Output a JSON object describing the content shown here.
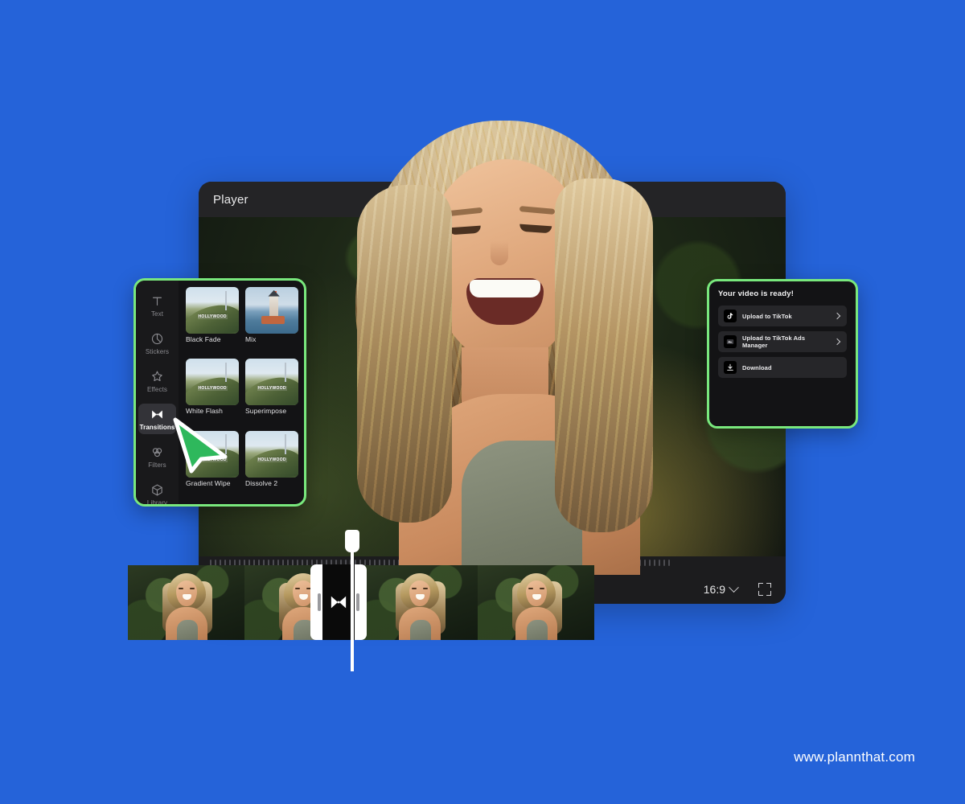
{
  "theme": {
    "background": "#2563d9",
    "panel_bg": "#131315",
    "panel_border_green": "#79e87d",
    "player_bg": "#1c1c1e",
    "titlebar_bg": "#242426",
    "accent_tick": "#2fb6a8",
    "cursor_green": "#2eb85c"
  },
  "player": {
    "title": "Player",
    "aspect_ratio": "16:9",
    "aspect_icon": "chevron-down-icon",
    "fullscreen_icon": "fullscreen-icon",
    "ruler_ticks": 96,
    "accent_tick_index": 52
  },
  "transitions_panel": {
    "sidebar": [
      {
        "label": "Text",
        "icon": "text-icon",
        "active": false
      },
      {
        "label": "Stickers",
        "icon": "sticker-icon",
        "active": false
      },
      {
        "label": "Effects",
        "icon": "effects-icon",
        "active": false
      },
      {
        "label": "Transitions",
        "icon": "transitions-icon",
        "active": true
      },
      {
        "label": "Filters",
        "icon": "filters-icon",
        "active": false
      },
      {
        "label": "Library",
        "icon": "library-icon",
        "active": false
      }
    ],
    "items": [
      {
        "name": "Black Fade",
        "thumb": "hill-sign"
      },
      {
        "name": "Mix",
        "thumb": "tower-sea"
      },
      {
        "name": "White Flash",
        "thumb": "hill-sign"
      },
      {
        "name": "Superimpose",
        "thumb": "hill-sign"
      },
      {
        "name": "Gradient Wipe",
        "thumb": "hill-sign"
      },
      {
        "name": "Dissolve 2",
        "thumb": "hill-sign"
      }
    ],
    "thumb_sign_text": "HOLLYWOOD"
  },
  "export_panel": {
    "title": "Your video is ready!",
    "options": [
      {
        "label": "Upload to TikTok",
        "icon": "tiktok-icon",
        "has_chevron": true
      },
      {
        "label": "Upload to TikTok Ads Manager",
        "icon": "tiktok-ads-icon",
        "has_chevron": true
      },
      {
        "label": "Download",
        "icon": "download-icon",
        "has_chevron": false
      }
    ]
  },
  "timeline": {
    "frame_count": 4,
    "transition_clip_icon": "transitions-icon",
    "playhead_label": "playhead"
  },
  "footer": {
    "watermark": "www.plannthat.com"
  }
}
